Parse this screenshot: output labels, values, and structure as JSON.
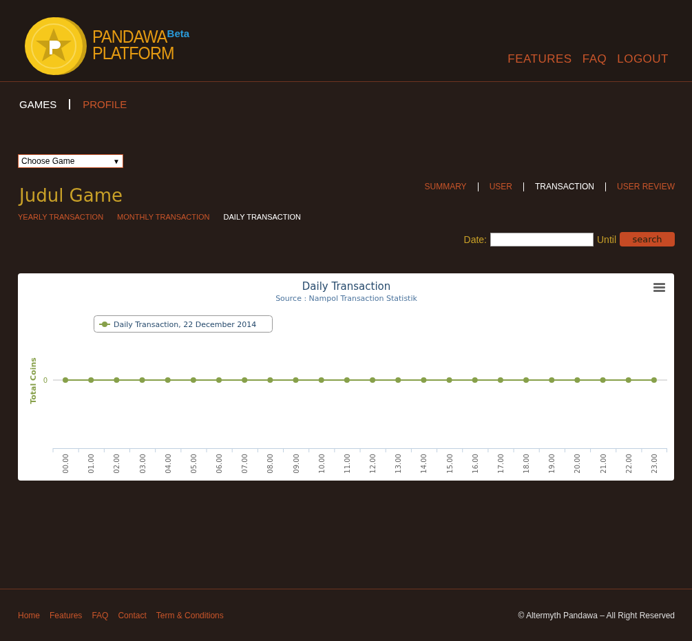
{
  "logo": {
    "name_line_1": "PANDAWA",
    "name_line_2": "PLATFORM",
    "badge": "Beta"
  },
  "top_nav": [
    {
      "label": "FEATURES"
    },
    {
      "label": "FAQ"
    },
    {
      "label": "LOGOUT"
    }
  ],
  "main_tabs": [
    {
      "label": "GAMES",
      "selected": true
    },
    {
      "label": "PROFILE",
      "selected": false
    }
  ],
  "game_select": {
    "value": "Choose Game",
    "arrow": "▼"
  },
  "game_title": "Judul Game",
  "section_tabs": [
    {
      "label": "SUMMARY",
      "selected": false
    },
    {
      "label": "USER",
      "selected": false
    },
    {
      "label": "TRANSACTION",
      "selected": true
    },
    {
      "label": "USER REVIEW",
      "selected": false
    }
  ],
  "period_tabs": [
    {
      "label": "YEARLY TRANSACTION",
      "selected": false
    },
    {
      "label": "MONTHLY TRANSACTION",
      "selected": false
    },
    {
      "label": "DAILY TRANSACTION",
      "selected": true
    }
  ],
  "date_filter": {
    "label": "Date:",
    "until": "Until",
    "button": "search"
  },
  "chart": {
    "title": "Daily Transaction",
    "subtitle": "Source : Nampol Transaction Statistik",
    "ylabel": "Total Coins",
    "y_tick_label": "0",
    "x_labels": [
      "00.00",
      "01.00",
      "02.00",
      "03.00",
      "04.00",
      "05.00",
      "06.00",
      "07.00",
      "08.00",
      "09.00",
      "10.00",
      "11.00",
      "12.00",
      "13.00",
      "14.00",
      "15.00",
      "16.00",
      "17.00",
      "18.00",
      "19.00",
      "20.00",
      "21.00",
      "22.00",
      "23.00"
    ],
    "legend": [
      {
        "name": "Daily Transaction, 22 December 2014",
        "color": "#87a04a"
      }
    ]
  },
  "footer": {
    "links": [
      "Home",
      "Features",
      "FAQ",
      "Contact",
      "Term & Conditions"
    ],
    "copyright": "© Altermyth Pandawa – All Right Reserved"
  }
}
